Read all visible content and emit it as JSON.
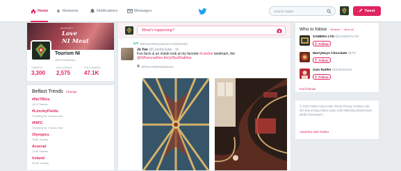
{
  "nav": {
    "home": "Home",
    "moments": "Moments",
    "notifications": "Notifications",
    "messages": "Messages",
    "search_placeholder": "Search Twitter",
    "tweet_button": "Tweet"
  },
  "profile": {
    "banner_line1": "AUGUST",
    "banner_line2": "Love",
    "banner_line3": "NI Meat",
    "name": "Tourism NI",
    "handle": "@NITravelBoard",
    "stats": [
      {
        "label": "TWEETS",
        "value": "3,300"
      },
      {
        "label": "FOLLOWING",
        "value": "2,575"
      },
      {
        "label": "FOLLOWERS",
        "value": "47.1K"
      }
    ]
  },
  "trends": {
    "title": "Belfast Trends",
    "change": "Change",
    "items": [
      {
        "name": "#NoTRins",
        "count": "1874 Tweets"
      },
      {
        "name": "#LincleyFields",
        "count": "Trending for 3 hours now"
      },
      {
        "name": "#NIFC",
        "count": "Trending for 3 hours now"
      },
      {
        "name": "Olympics",
        "count": "754K Tweets"
      },
      {
        "name": "Arsenal",
        "count": "178K Tweets"
      },
      {
        "name": "Ireland",
        "count": "33.6K Tweets"
      }
    ]
  },
  "composer": {
    "placeholder": "What's happening?"
  },
  "tweet": {
    "retweet_label": "BIFencesRenaissance Retweeted",
    "author_name": "Jo Yee",
    "author_handle": "@CanddyJude · 1h",
    "text_before": "Fun facts & an inside look at my favorite ",
    "text_highlight": "#London",
    "text_after": " landmark, the",
    "text_line2": "@StPancrasRen bit.ly/2buDhatNoo",
    "place": "StPancrasRenaissance"
  },
  "who_to_follow": {
    "title": "Who to follow",
    "refresh": "· Refresh",
    "view_all": "· View all",
    "items": [
      {
        "name": "SAMERA LTD",
        "handle": "@SAMERALTD",
        "button": "Follow"
      },
      {
        "name": "MarryNoys Chocolate",
        "handle": "@PS",
        "button": "Follow"
      },
      {
        "name": "Sam Rattler",
        "handle": "@SaleStores",
        "button": "Follow"
      }
    ],
    "find_friends": "Find friends"
  },
  "footer": {
    "links": "© 2016 Twitter  About  Help  Terms  Privacy  Cookies  Ads info  Brand  Blog  Status  Apps  Jobs  Marketing  Businesses  Media  Developers",
    "advertise": "Advertise with Twitter"
  },
  "colors": {
    "accent": "#e0245e",
    "background": "#e8ecef",
    "card": "#ffffff",
    "twitter_blue": "#1da1f2"
  }
}
